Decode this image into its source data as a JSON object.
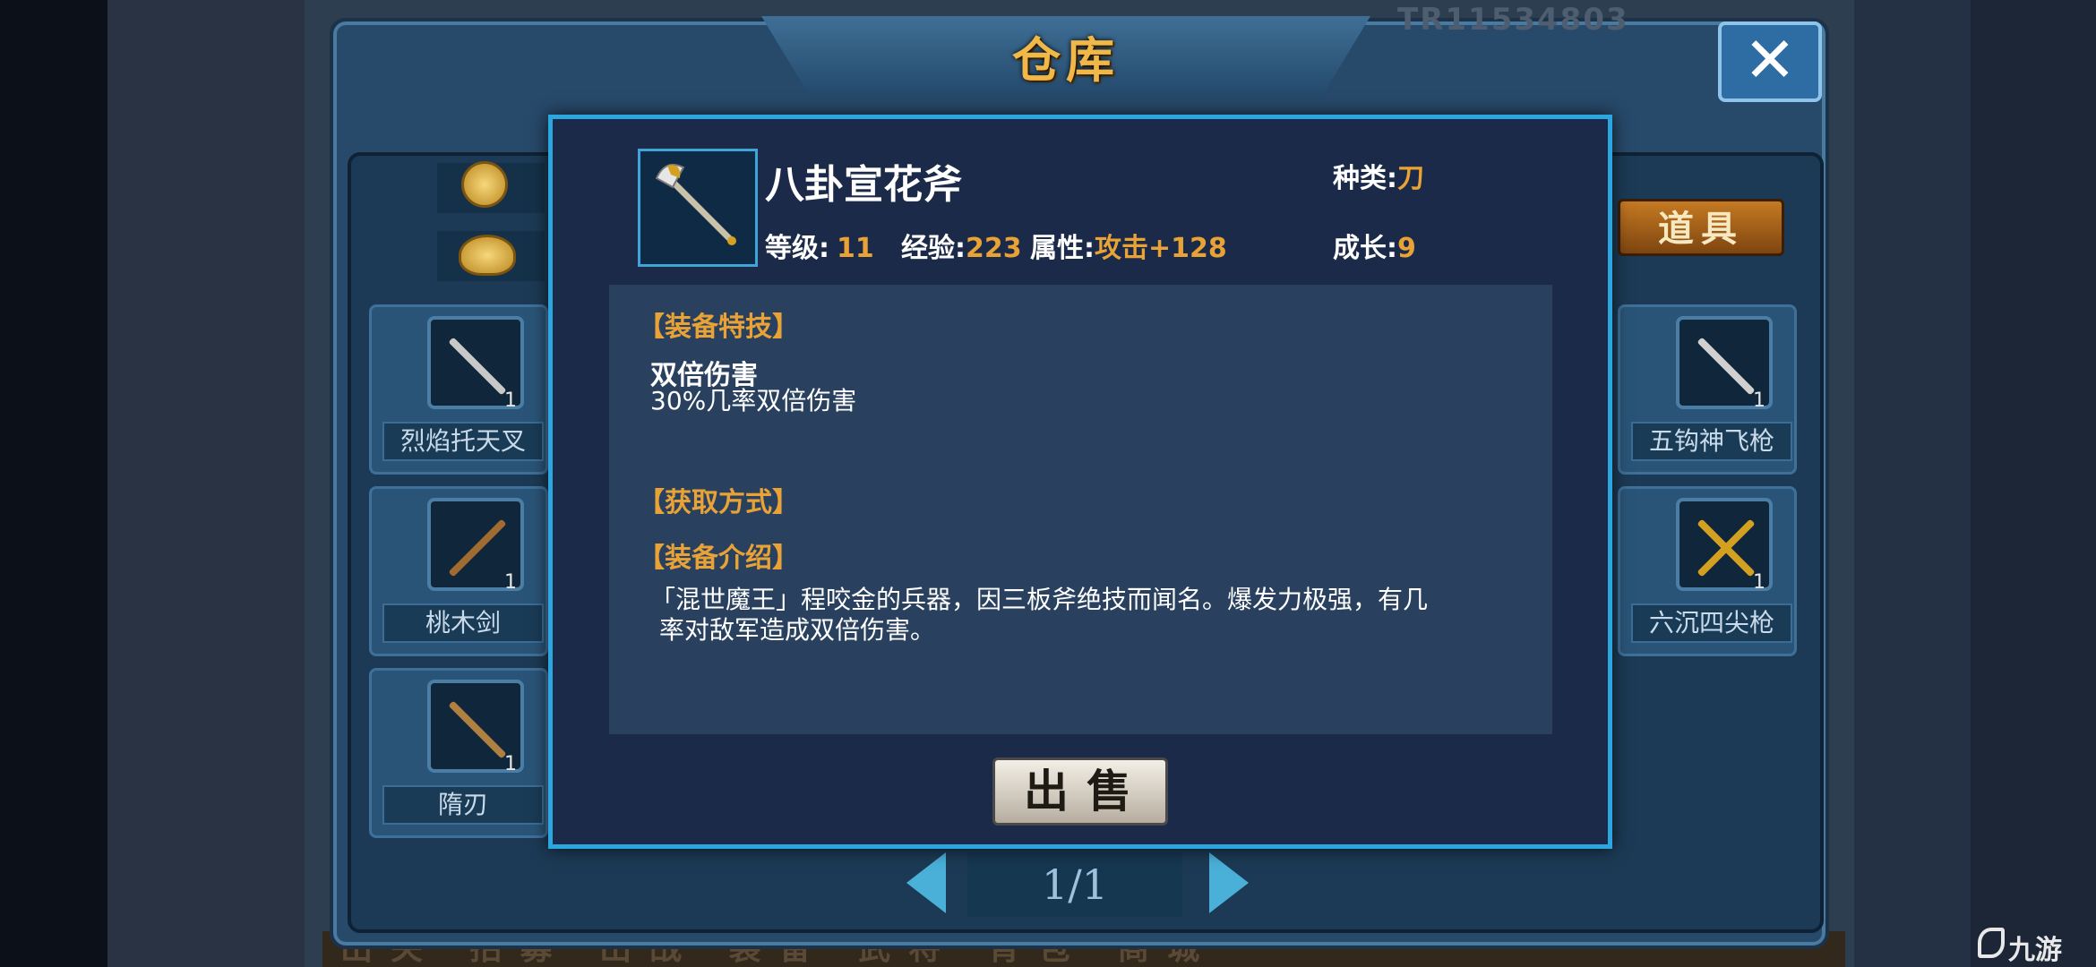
{
  "window": {
    "title": "仓库",
    "close_label": "✕",
    "player_id": "TR11534803"
  },
  "currency": {
    "coin_icon": "copper-coin-icon",
    "ingot_icon": "gold-ingot-icon"
  },
  "tabs": {
    "items_label": "道具"
  },
  "slots_left": [
    {
      "name": "烈焰托天叉",
      "count": "1",
      "icon": "trident-icon",
      "color": "#c8c8c8"
    },
    {
      "name": "桃木剑",
      "count": "1",
      "icon": "wooden-sword-icon",
      "color": "#a06a30"
    },
    {
      "name": "隋刃",
      "count": "1",
      "icon": "blade-icon",
      "color": "#b08040"
    }
  ],
  "slots_right": [
    {
      "name": "五钩神飞枪",
      "count": "1",
      "icon": "spear-icon",
      "color": "#d0d0d0"
    },
    {
      "name": "六沉四尖枪",
      "count": "1",
      "icon": "crossed-spears-icon",
      "color": "#d4a020"
    }
  ],
  "pager": {
    "text": "1/1"
  },
  "detail": {
    "item_name": "八卦宣花斧",
    "icon": "battle-axe-icon",
    "type_label": "种类:",
    "type_value": "刀",
    "level_label": "等级:",
    "level_value": "11",
    "exp_label": "经验:",
    "exp_value": "223",
    "attr_label": "属性:",
    "attr_value": "攻击+128",
    "growth_label": "成长:",
    "growth_value": "9",
    "skill_section": "【装备特技】",
    "skill_name": "双倍伤害",
    "skill_desc": "30%几率双倍伤害",
    "source_section": "【获取方式】",
    "intro_section": "【装备介绍】",
    "intro_line1": "「混世魔王」程咬金的兵器，因三板斧绝技而闻名。爆发力极强，有几",
    "intro_line2": "率对敌军造成双倍伤害。",
    "sell_label": "出售"
  },
  "bottom_bar": {
    "text": "出关 招募 出战 装备 武将 背包 商城"
  },
  "watermark": {
    "text": "九游"
  },
  "colors": {
    "accent_gold": "#e9a235",
    "popup_border": "#2ba6df",
    "panel_bg": "#29415f"
  }
}
